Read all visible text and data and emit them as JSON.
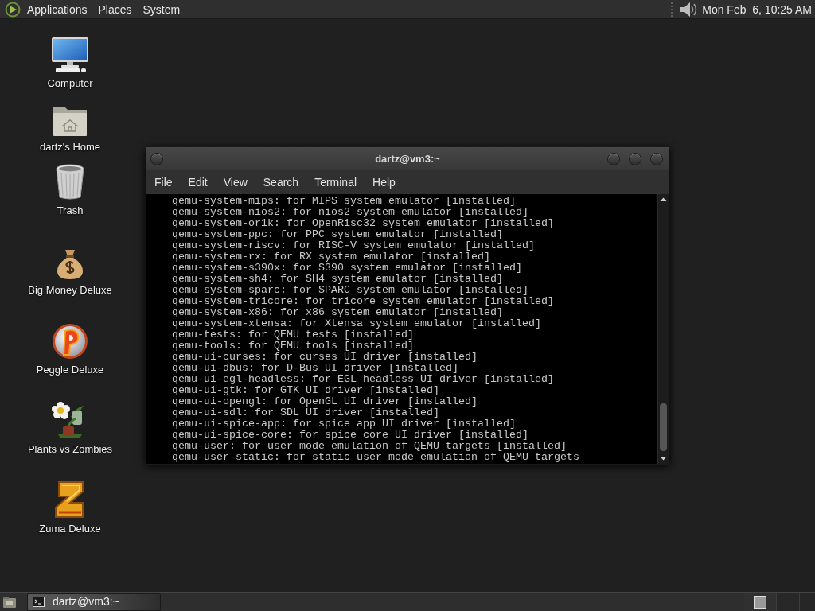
{
  "top_panel": {
    "menus": [
      "Applications",
      "Places",
      "System"
    ],
    "clock": "Mon Feb  6, 10:25 AM"
  },
  "desktop": {
    "icons": [
      {
        "label": "Computer",
        "kind": "computer"
      },
      {
        "label": "dartz's Home",
        "kind": "home"
      },
      {
        "label": "Trash",
        "kind": "trash"
      },
      {
        "label": "Big Money Deluxe",
        "kind": "moneybag"
      },
      {
        "label": "Peggle Deluxe",
        "kind": "ball"
      },
      {
        "label": "Plants vs Zombies",
        "kind": "plant"
      },
      {
        "label": "Zuma Deluxe",
        "kind": "block"
      }
    ]
  },
  "terminal": {
    "title": "dartz@vm3:~",
    "menus": [
      "File",
      "Edit",
      "View",
      "Search",
      "Terminal",
      "Help"
    ],
    "lines": [
      "qemu-system-mips: for MIPS system emulator [installed]",
      "qemu-system-nios2: for nios2 system emulator [installed]",
      "qemu-system-or1k: for OpenRisc32 system emulator [installed]",
      "qemu-system-ppc: for PPC system emulator [installed]",
      "qemu-system-riscv: for RISC-V system emulator [installed]",
      "qemu-system-rx: for RX system emulator [installed]",
      "qemu-system-s390x: for S390 system emulator [installed]",
      "qemu-system-sh4: for SH4 system emulator [installed]",
      "qemu-system-sparc: for SPARC system emulator [installed]",
      "qemu-system-tricore: for tricore system emulator [installed]",
      "qemu-system-x86: for x86 system emulator [installed]",
      "qemu-system-xtensa: for Xtensa system emulator [installed]",
      "qemu-tests: for QEMU tests [installed]",
      "qemu-tools: for QEMU tools [installed]",
      "qemu-ui-curses: for curses UI driver [installed]",
      "qemu-ui-dbus: for D-Bus UI driver [installed]",
      "qemu-ui-egl-headless: for EGL headless UI driver [installed]",
      "qemu-ui-gtk: for GTK UI driver [installed]",
      "qemu-ui-opengl: for OpenGL UI driver [installed]",
      "qemu-ui-sdl: for SDL UI driver [installed]",
      "qemu-ui-spice-app: for spice app UI driver [installed]",
      "qemu-ui-spice-core: for spice core UI driver [installed]",
      "qemu-user: for user mode emulation of QEMU targets [installed]",
      "qemu-user-static: for static user mode emulation of QEMU targets"
    ]
  },
  "taskbar": {
    "windows": [
      {
        "label": "dartz@vm3:~",
        "selected": true
      }
    ]
  }
}
